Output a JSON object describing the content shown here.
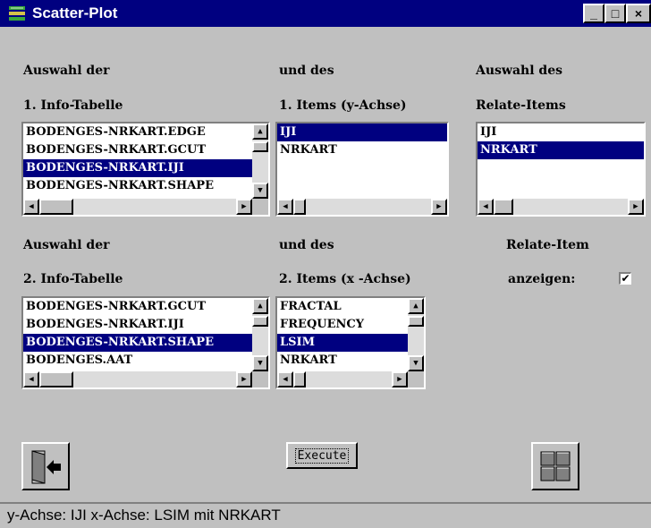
{
  "window": {
    "title": "Scatter-Plot",
    "min_label": "_",
    "max_label": "□",
    "close_label": "×"
  },
  "labels": {
    "sel1_line1": "Auswahl der",
    "sel1_line2": "1. Info-Tabelle",
    "items1_line1": "und des",
    "items1_line2": "1. Items (y-Achse)",
    "relate_line1": "Auswahl des",
    "relate_line2": "Relate-Items",
    "sel2_line1": "Auswahl der",
    "sel2_line2": "2. Info-Tabelle",
    "items2_line1": "und des",
    "items2_line2": "2. Items (x -Achse)",
    "relshow_line1": "Relate-Item",
    "relshow_line2": "anzeigen:"
  },
  "lists": {
    "table1": {
      "items": [
        "BODENGES-NRKART.EDGE",
        "BODENGES-NRKART.GCUT",
        "BODENGES-NRKART.IJI",
        "BODENGES-NRKART.SHAPE"
      ],
      "selected": 2
    },
    "items1": {
      "items": [
        "IJI",
        "NRKART"
      ],
      "selected": 0
    },
    "relate": {
      "items": [
        "IJI",
        "NRKART"
      ],
      "selected": 1
    },
    "table2": {
      "items": [
        "BODENGES-NRKART.GCUT",
        "BODENGES-NRKART.IJI",
        "BODENGES-NRKART.SHAPE",
        "BODENGES.AAT"
      ],
      "selected": 2
    },
    "items2": {
      "items": [
        "FRACTAL",
        "FREQUENCY",
        "LSIM",
        "NRKART"
      ],
      "selected": 2
    }
  },
  "relate_show_checked": true,
  "checkbox_mark": "✔",
  "buttons": {
    "execute_label": "Execute",
    "exit_icon": "exit-door-icon",
    "grid_icon": "grid-icon"
  },
  "status": {
    "text": "y-Achse: IJI x-Achse: LSIM mit NRKART"
  },
  "colors": {
    "titlebar": "#000080",
    "selection": "#000080",
    "background": "#c0c0c0"
  }
}
